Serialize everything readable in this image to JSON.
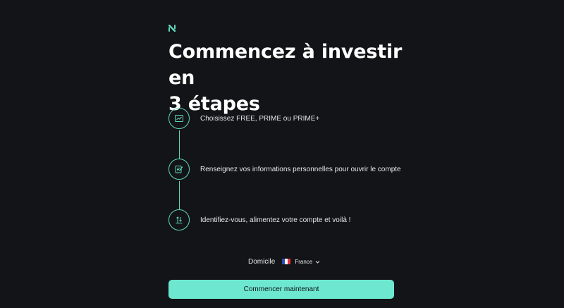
{
  "colors": {
    "background": "#131417",
    "accent": "#5fd6bd",
    "button_bg": "#6de7d0",
    "text": "#ffffff"
  },
  "logo": {
    "icon": "brand-logo-icon"
  },
  "headline": {
    "line1": "Commencez à investir en",
    "line2": "3 étapes"
  },
  "steps": [
    {
      "icon": "chart-icon",
      "label": "Choisissez FREE, PRIME ou PRIME+"
    },
    {
      "icon": "edit-document-icon",
      "label": "Renseignez vos informations personnelles pour ouvrir le compte"
    },
    {
      "icon": "transfer-icon",
      "label": "Identifiez-vous, alimentez votre compte et voilà !"
    }
  ],
  "domicile": {
    "label": "Domicile",
    "country": "France",
    "flag_icon": "france-flag-icon"
  },
  "cta": {
    "label": "Commencer maintenant"
  }
}
